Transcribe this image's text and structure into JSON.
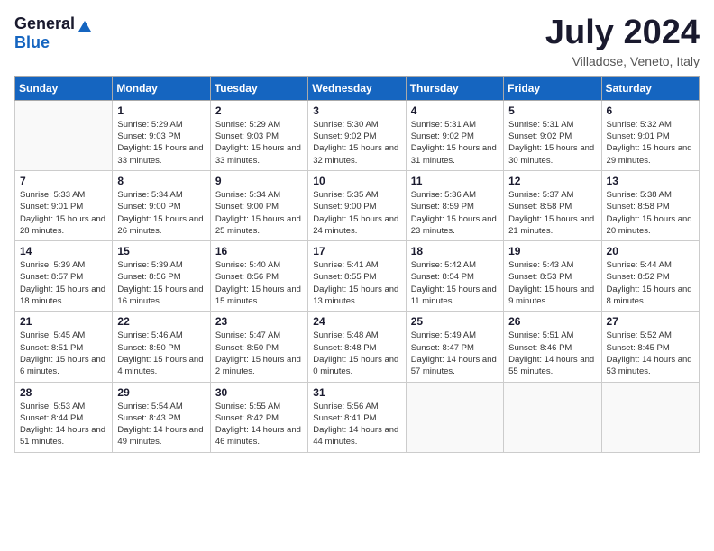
{
  "logo": {
    "general": "General",
    "blue": "Blue"
  },
  "title": "July 2024",
  "location": "Villadose, Veneto, Italy",
  "weekdays": [
    "Sunday",
    "Monday",
    "Tuesday",
    "Wednesday",
    "Thursday",
    "Friday",
    "Saturday"
  ],
  "weeks": [
    [
      {
        "day": "",
        "sunrise": "",
        "sunset": "",
        "daylight": ""
      },
      {
        "day": "1",
        "sunrise": "Sunrise: 5:29 AM",
        "sunset": "Sunset: 9:03 PM",
        "daylight": "Daylight: 15 hours and 33 minutes."
      },
      {
        "day": "2",
        "sunrise": "Sunrise: 5:29 AM",
        "sunset": "Sunset: 9:03 PM",
        "daylight": "Daylight: 15 hours and 33 minutes."
      },
      {
        "day": "3",
        "sunrise": "Sunrise: 5:30 AM",
        "sunset": "Sunset: 9:02 PM",
        "daylight": "Daylight: 15 hours and 32 minutes."
      },
      {
        "day": "4",
        "sunrise": "Sunrise: 5:31 AM",
        "sunset": "Sunset: 9:02 PM",
        "daylight": "Daylight: 15 hours and 31 minutes."
      },
      {
        "day": "5",
        "sunrise": "Sunrise: 5:31 AM",
        "sunset": "Sunset: 9:02 PM",
        "daylight": "Daylight: 15 hours and 30 minutes."
      },
      {
        "day": "6",
        "sunrise": "Sunrise: 5:32 AM",
        "sunset": "Sunset: 9:01 PM",
        "daylight": "Daylight: 15 hours and 29 minutes."
      }
    ],
    [
      {
        "day": "7",
        "sunrise": "Sunrise: 5:33 AM",
        "sunset": "Sunset: 9:01 PM",
        "daylight": "Daylight: 15 hours and 28 minutes."
      },
      {
        "day": "8",
        "sunrise": "Sunrise: 5:34 AM",
        "sunset": "Sunset: 9:00 PM",
        "daylight": "Daylight: 15 hours and 26 minutes."
      },
      {
        "day": "9",
        "sunrise": "Sunrise: 5:34 AM",
        "sunset": "Sunset: 9:00 PM",
        "daylight": "Daylight: 15 hours and 25 minutes."
      },
      {
        "day": "10",
        "sunrise": "Sunrise: 5:35 AM",
        "sunset": "Sunset: 9:00 PM",
        "daylight": "Daylight: 15 hours and 24 minutes."
      },
      {
        "day": "11",
        "sunrise": "Sunrise: 5:36 AM",
        "sunset": "Sunset: 8:59 PM",
        "daylight": "Daylight: 15 hours and 23 minutes."
      },
      {
        "day": "12",
        "sunrise": "Sunrise: 5:37 AM",
        "sunset": "Sunset: 8:58 PM",
        "daylight": "Daylight: 15 hours and 21 minutes."
      },
      {
        "day": "13",
        "sunrise": "Sunrise: 5:38 AM",
        "sunset": "Sunset: 8:58 PM",
        "daylight": "Daylight: 15 hours and 20 minutes."
      }
    ],
    [
      {
        "day": "14",
        "sunrise": "Sunrise: 5:39 AM",
        "sunset": "Sunset: 8:57 PM",
        "daylight": "Daylight: 15 hours and 18 minutes."
      },
      {
        "day": "15",
        "sunrise": "Sunrise: 5:39 AM",
        "sunset": "Sunset: 8:56 PM",
        "daylight": "Daylight: 15 hours and 16 minutes."
      },
      {
        "day": "16",
        "sunrise": "Sunrise: 5:40 AM",
        "sunset": "Sunset: 8:56 PM",
        "daylight": "Daylight: 15 hours and 15 minutes."
      },
      {
        "day": "17",
        "sunrise": "Sunrise: 5:41 AM",
        "sunset": "Sunset: 8:55 PM",
        "daylight": "Daylight: 15 hours and 13 minutes."
      },
      {
        "day": "18",
        "sunrise": "Sunrise: 5:42 AM",
        "sunset": "Sunset: 8:54 PM",
        "daylight": "Daylight: 15 hours and 11 minutes."
      },
      {
        "day": "19",
        "sunrise": "Sunrise: 5:43 AM",
        "sunset": "Sunset: 8:53 PM",
        "daylight": "Daylight: 15 hours and 9 minutes."
      },
      {
        "day": "20",
        "sunrise": "Sunrise: 5:44 AM",
        "sunset": "Sunset: 8:52 PM",
        "daylight": "Daylight: 15 hours and 8 minutes."
      }
    ],
    [
      {
        "day": "21",
        "sunrise": "Sunrise: 5:45 AM",
        "sunset": "Sunset: 8:51 PM",
        "daylight": "Daylight: 15 hours and 6 minutes."
      },
      {
        "day": "22",
        "sunrise": "Sunrise: 5:46 AM",
        "sunset": "Sunset: 8:50 PM",
        "daylight": "Daylight: 15 hours and 4 minutes."
      },
      {
        "day": "23",
        "sunrise": "Sunrise: 5:47 AM",
        "sunset": "Sunset: 8:50 PM",
        "daylight": "Daylight: 15 hours and 2 minutes."
      },
      {
        "day": "24",
        "sunrise": "Sunrise: 5:48 AM",
        "sunset": "Sunset: 8:48 PM",
        "daylight": "Daylight: 15 hours and 0 minutes."
      },
      {
        "day": "25",
        "sunrise": "Sunrise: 5:49 AM",
        "sunset": "Sunset: 8:47 PM",
        "daylight": "Daylight: 14 hours and 57 minutes."
      },
      {
        "day": "26",
        "sunrise": "Sunrise: 5:51 AM",
        "sunset": "Sunset: 8:46 PM",
        "daylight": "Daylight: 14 hours and 55 minutes."
      },
      {
        "day": "27",
        "sunrise": "Sunrise: 5:52 AM",
        "sunset": "Sunset: 8:45 PM",
        "daylight": "Daylight: 14 hours and 53 minutes."
      }
    ],
    [
      {
        "day": "28",
        "sunrise": "Sunrise: 5:53 AM",
        "sunset": "Sunset: 8:44 PM",
        "daylight": "Daylight: 14 hours and 51 minutes."
      },
      {
        "day": "29",
        "sunrise": "Sunrise: 5:54 AM",
        "sunset": "Sunset: 8:43 PM",
        "daylight": "Daylight: 14 hours and 49 minutes."
      },
      {
        "day": "30",
        "sunrise": "Sunrise: 5:55 AM",
        "sunset": "Sunset: 8:42 PM",
        "daylight": "Daylight: 14 hours and 46 minutes."
      },
      {
        "day": "31",
        "sunrise": "Sunrise: 5:56 AM",
        "sunset": "Sunset: 8:41 PM",
        "daylight": "Daylight: 14 hours and 44 minutes."
      },
      {
        "day": "",
        "sunrise": "",
        "sunset": "",
        "daylight": ""
      },
      {
        "day": "",
        "sunrise": "",
        "sunset": "",
        "daylight": ""
      },
      {
        "day": "",
        "sunrise": "",
        "sunset": "",
        "daylight": ""
      }
    ]
  ]
}
